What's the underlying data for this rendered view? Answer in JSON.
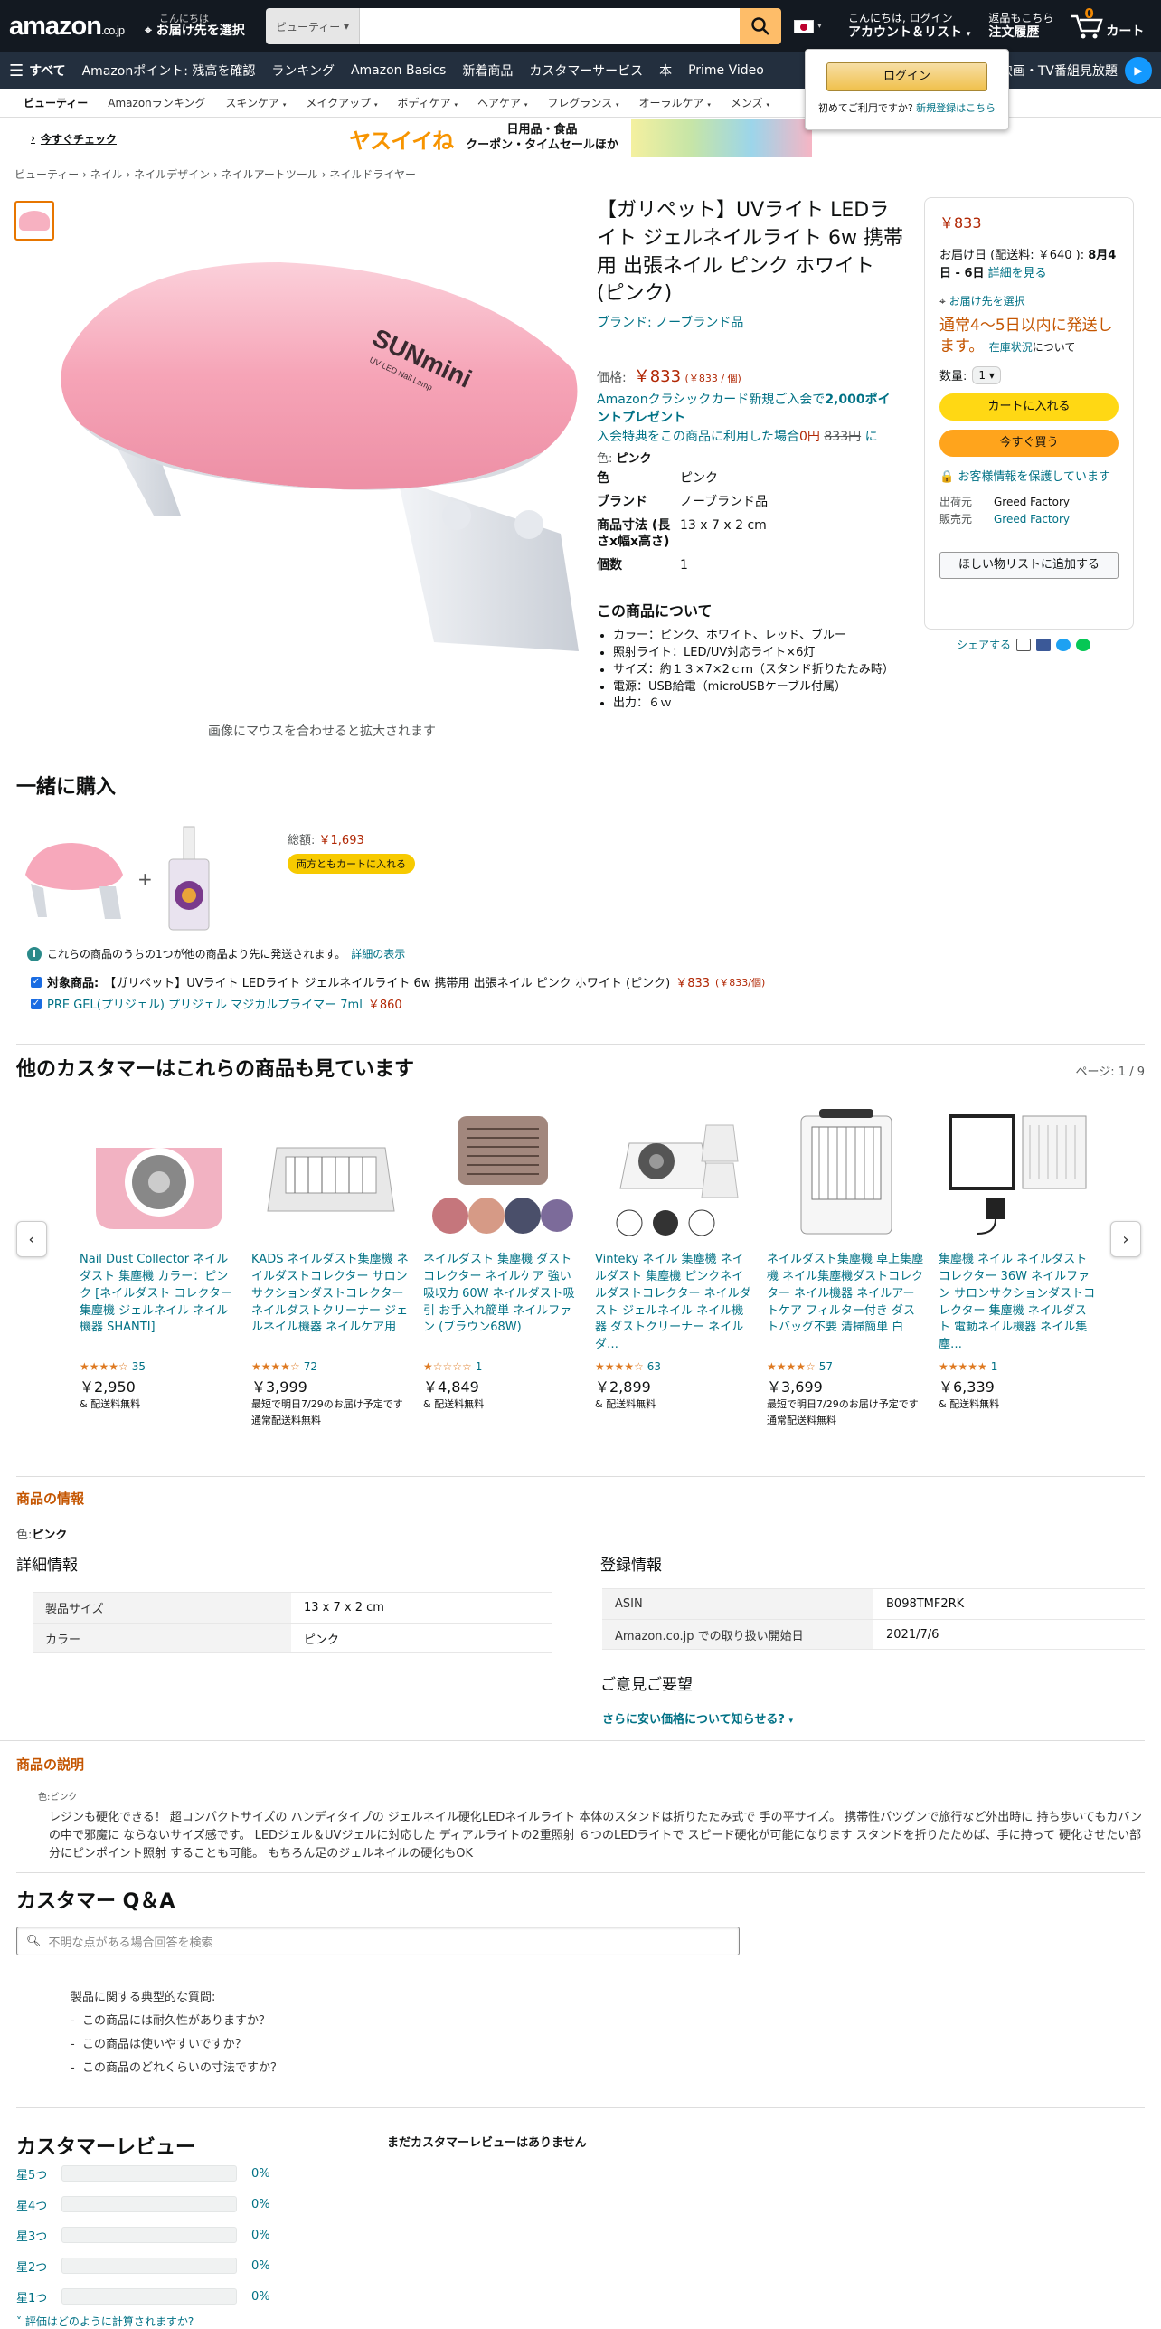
{
  "header": {
    "logo": "amazon",
    "logo_suffix": ".co.jp",
    "deliver_line1": "こんにちは",
    "deliver_line2": "お届け先を選択",
    "search_category": "ビューティー",
    "account_line1": "こんにちは, ログイン",
    "account_line2": "アカウント＆リスト",
    "orders_line1": "返品もこちら",
    "orders_line2": "注文履歴",
    "cart_count": "0",
    "cart_label": "カート"
  },
  "nav2": {
    "all": "すべて",
    "items": [
      "Amazonポイント: 残高を確認",
      "ランキング",
      "Amazon Basics",
      "新着商品",
      "カスタマーサービス",
      "本",
      "Prime Video"
    ],
    "right": "映画・TV番組見放題"
  },
  "login_popup": {
    "button": "ログイン",
    "new_text": "初めてご利用ですか?",
    "new_link": "新規登録はこちら"
  },
  "subnav": [
    "ビューティー",
    "Amazonランキング",
    "スキンケア",
    "メイクアップ",
    "ボディケア",
    "ヘアケア",
    "フレグランス",
    "オーラルケア",
    "メンズ"
  ],
  "banner": {
    "brand": "ヤスイイね",
    "line1": "日用品・食品",
    "line2": "クーポン・タイムセールほか",
    "cta": "今すぐチェック"
  },
  "breadcrumb": [
    "ビューティー",
    "ネイル",
    "ネイルデザイン",
    "ネイルアートツール",
    "ネイルドライヤー"
  ],
  "product": {
    "image_brand_text": "SUNmini",
    "image_sub_text": "UV LED Nail Lamp",
    "hover_hint": "画像にマウスを合わせると拡大されます",
    "title": "【ガリペット】UVライト LEDライト ジェルネイルライト 6w 携帯用 出張ネイル ピンク ホワイト (ピンク)",
    "brand": "ブランド: ノーブランド品",
    "price_label": "価格:",
    "price": "￥833",
    "unit_price": "(￥833 / 個)",
    "promo_line1": "Amazonクラシックカード新規ご入会で",
    "promo_points": "2,000ポイントプレゼント",
    "promo_line2": "入会特典をこの商品に利用した場合",
    "promo_zero": "0円",
    "promo_strike": "833円",
    "promo_ni": "に",
    "color_label": "色:",
    "color_value": "ピンク",
    "specs": [
      {
        "k": "色",
        "v": "ピンク"
      },
      {
        "k": "ブランド",
        "v": "ノーブランド品"
      },
      {
        "k": "商品寸法 (長さx幅x高さ)",
        "v": "13 x 7 x 2 cm"
      },
      {
        "k": "個数",
        "v": "1"
      }
    ],
    "about_title": "この商品について",
    "about": [
      "カラー：ピンク、ホワイト、レッド、ブルー",
      "照射ライト：LED/UV対応ライト×6灯",
      "サイズ：約１３×7×2ｃｍ（スタンド折りたたみ時）",
      "電源：USB給電（microUSBケーブル付属）",
      "出力：６ｗ"
    ]
  },
  "buybox": {
    "price": "￥833",
    "delivery_prefix": "お届け日 (配送料: ￥640 ):",
    "delivery_date": "8月4日 - 6日",
    "delivery_link": "詳細を見る",
    "address": "お届け先を選択",
    "stock": "通常4～5日以内に発送します。",
    "stock_link": "在庫状況",
    "stock_suffix": "について",
    "qty_label": "数量:",
    "qty": "1",
    "add_cart": "カートに入れる",
    "buy_now": "今すぐ買う",
    "secure": "お客様情報を保護しています",
    "shipper_label": "出荷元",
    "shipper": "Greed Factory",
    "seller_label": "販売元",
    "seller": "Greed Factory",
    "wishlist": "ほしい物リストに追加する",
    "share": "シェアする"
  },
  "fbt": {
    "title": "一緒に購入",
    "total_label": "総額:",
    "total": "￥1,693",
    "add_both": "両方ともカートに入れる",
    "info": "これらの商品のうちの1つが他の商品より先に発送されます。",
    "info_link": "詳細の表示",
    "item1_label": "対象商品:",
    "item1": "【ガリペット】UVライト LEDライト ジェルネイルライト 6w 携帯用 出張ネイル ピンク ホワイト (ピンク)",
    "item1_price": "￥833",
    "item1_unit": "(￥833/個)",
    "item2": "PRE GEL(プリジェル) プリジェル マジカルプライマー 7ml",
    "item2_price": "￥860"
  },
  "also_viewed": {
    "title": "他のカスタマーはこれらの商品も見ています",
    "page": "ページ: 1 / 9",
    "items": [
      {
        "title": "Nail Dust Collector ネイルダスト 集塵機 カラー：ピンク [ネイルダスト コレクター 集塵機 ジェルネイル ネイル機器 SHANTI]",
        "stars": "★★★★☆",
        "count": "35",
        "price": "￥2,950",
        "ship1": "& 配送料無料",
        "ship2": "",
        "ship3": ""
      },
      {
        "title": "KADS ネイルダスト集塵機 ネイルダストコレクター サロンサクションダストコレクター ネイルダストクリーナー ジェルネイル機器 ネイルケア用",
        "stars": "★★★★☆",
        "count": "72",
        "price": "￥3,999",
        "ship1": "最短で明日7/29のお届け予定です",
        "ship2": "通常配送料無料",
        "ship3": ""
      },
      {
        "title": "ネイルダスト 集塵機 ダストコレクター ネイルケア 強い吸収力 60W ネイルダスト吸引 お手入れ簡単 ネイルファン (ブラウン68W)",
        "stars": "★☆☆☆☆",
        "count": "1",
        "price": "￥4,849",
        "ship1": "& 配送料無料",
        "ship2": "",
        "ship3": ""
      },
      {
        "title": "Vinteky ネイル 集塵機 ネイルダスト 集塵機 ピンクネイルダストコレクター ネイルダスト ジェルネイル ネイル機器 ダストクリーナー ネイルダ…",
        "stars": "★★★★☆",
        "count": "63",
        "price": "￥2,899",
        "ship1": "& 配送料無料",
        "ship2": "",
        "ship3": ""
      },
      {
        "title": "ネイルダスト集塵機 卓上集塵機 ネイル集塵機ダストコレクター ネイル機器 ネイルアートケア フィルター付き ダストバッグ不要 清掃簡単 白",
        "stars": "★★★★☆",
        "count": "57",
        "price": "￥3,699",
        "ship1": "最短で明日7/29のお届け予定です",
        "ship2": "通常配送料無料",
        "ship3": ""
      },
      {
        "title": "集塵機 ネイル ネイルダストコレクター 36W ネイルファン サロンサクションダストコレクター 集塵機 ネイルダスト 電動ネイル機器 ネイル集塵…",
        "stars": "★★★★★",
        "count": "1",
        "price": "￥6,339",
        "ship1": "& 配送料無料",
        "ship2": "",
        "ship3": ""
      }
    ]
  },
  "info_section": {
    "title": "商品の情報",
    "color_label": "色:",
    "color_value": "ピンク",
    "detail_title": "詳細情報",
    "detail_rows": [
      {
        "k": "製品サイズ",
        "v": "13 x 7 x 2 cm"
      },
      {
        "k": "カラー",
        "v": "ピンク"
      }
    ],
    "reg_title": "登録情報",
    "reg_rows": [
      {
        "k": "ASIN",
        "v": "B098TMF2RK"
      },
      {
        "k": "Amazon.co.jp での取り扱い開始日",
        "v": "2021/7/6"
      }
    ],
    "feedback_title": "ご意見ご要望",
    "feedback_link": "さらに安い価格について知らせる?"
  },
  "description": {
    "title": "商品の説明",
    "color": "色:ピンク",
    "text": "レジンも硬化できる！ 超コンパクトサイズの ハンディタイプの ジェルネイル硬化LEDネイルライト 本体のスタンドは折りたたみ式で 手の平サイズ。 携帯性バツグンで旅行など外出時に 持ち歩いてもカバンの中で邪魔に ならないサイズ感です。 LEDジェル＆UVジェルに対応した ディアルライトの2重照射 ６つのLEDライトで スピード硬化が可能になります スタンドを折りたためば、手に持って 硬化させたい部分にピンポイント照射 することも可能。 もちろん足のジェルネイルの硬化もOK"
  },
  "qa": {
    "title": "カスタマー Q＆A",
    "placeholder": "不明な点がある場合回答を検索",
    "typical_title": "製品に関する典型的な質問:",
    "questions": [
      "この商品には耐久性がありますか？",
      "この商品は使いやすいですか？",
      "この商品のどれくらいの寸法ですか？"
    ]
  },
  "reviews": {
    "title": "カスタマーレビュー",
    "none": "まだカスタマーレビューはありません",
    "rows": [
      {
        "label": "星5つ",
        "pct": "0%"
      },
      {
        "label": "星4つ",
        "pct": "0%"
      },
      {
        "label": "星3つ",
        "pct": "0%"
      },
      {
        "label": "星2つ",
        "pct": "0%"
      },
      {
        "label": "星1つ",
        "pct": "0%"
      }
    ],
    "how": "評価はどのように計算されますか?"
  }
}
